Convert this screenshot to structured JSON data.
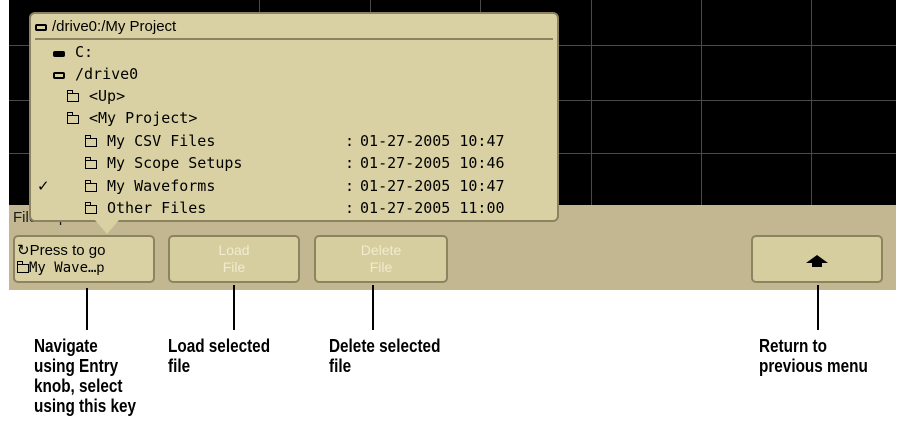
{
  "menu": {
    "title_stub": "File Explorer Menu",
    "softkeys": [
      {
        "line1": "Press to go",
        "line2": "My Wave…",
        "trail": "p",
        "icon": "rotate-icon"
      },
      {
        "line1": "Load",
        "line2": "File"
      },
      {
        "line1": "Delete",
        "line2": "File"
      },
      {
        "icon": "up-arrow-icon"
      }
    ]
  },
  "browser": {
    "title": "/drive0:/My Project",
    "tree": [
      {
        "name": "C:",
        "icon": "drive-icon"
      },
      {
        "name": "/drive0",
        "icon": "usb-drive-icon"
      },
      {
        "name": "<Up>",
        "icon": "folder-up-icon"
      },
      {
        "name": "<My Project>",
        "icon": "folder-open-icon"
      },
      {
        "name": "My CSV Files",
        "date": "01-27-2005 10:47",
        "icon": "folder-icon",
        "selected": false
      },
      {
        "name": "My Scope Setups",
        "date": "01-27-2005 10:46",
        "icon": "folder-icon",
        "selected": false
      },
      {
        "name": "My Waveforms",
        "date": "01-27-2005 10:47",
        "icon": "folder-icon",
        "selected": true
      },
      {
        "name": "Other Files",
        "date": "01-27-2005 11:00",
        "icon": "folder-icon",
        "selected": false
      }
    ],
    "check": "✓",
    "sep": ":"
  },
  "callouts": {
    "navigate": "Navigate\nusing Entry\nknob, select\nusing this key",
    "load": "Load selected\nfile",
    "delete": "Delete selected\nfile",
    "return": "Return to\nprevious menu"
  },
  "colors": {
    "softkey_bg": "#d6ce9e",
    "panel": "#c2b790",
    "screen": "#000000"
  }
}
